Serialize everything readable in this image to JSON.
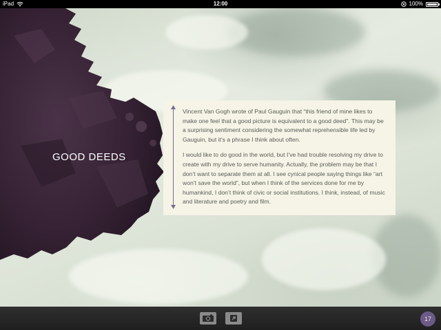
{
  "status_bar": {
    "device": "iPad",
    "time": "12:00",
    "battery": "100%"
  },
  "section_title": "GOOD DEEDS",
  "card": {
    "paragraphs": [
      "Vincent Van Gogh wrote of Paul Gauguin that “this friend of mine likes to make one feel that a good picture is equivalent to a good deed”. This may be a surprising sentiment considering the somewhat reprehensible life led by Gauguin, but it’s a phrase I think about often.",
      "I would like to do good in the world, but I’ve had trouble resolving my drive to create with my drive to serve humanity. Actually, the problem may be that I don’t want to separate them at all. I see cynical people saying things like “art won’t save the world”, but when I think of the services done for me by humankind, I don’t think of civic or social institutions. I think, instead, of music and literature and poetry and film."
    ]
  },
  "toolbar": {
    "camera_icon": "camera-icon",
    "share_icon": "share-arrow-icon",
    "page_number": "17"
  },
  "colors": {
    "card_bg": "#f5f4e6",
    "rock": "#3a2438",
    "badge": "#6c5a86"
  }
}
